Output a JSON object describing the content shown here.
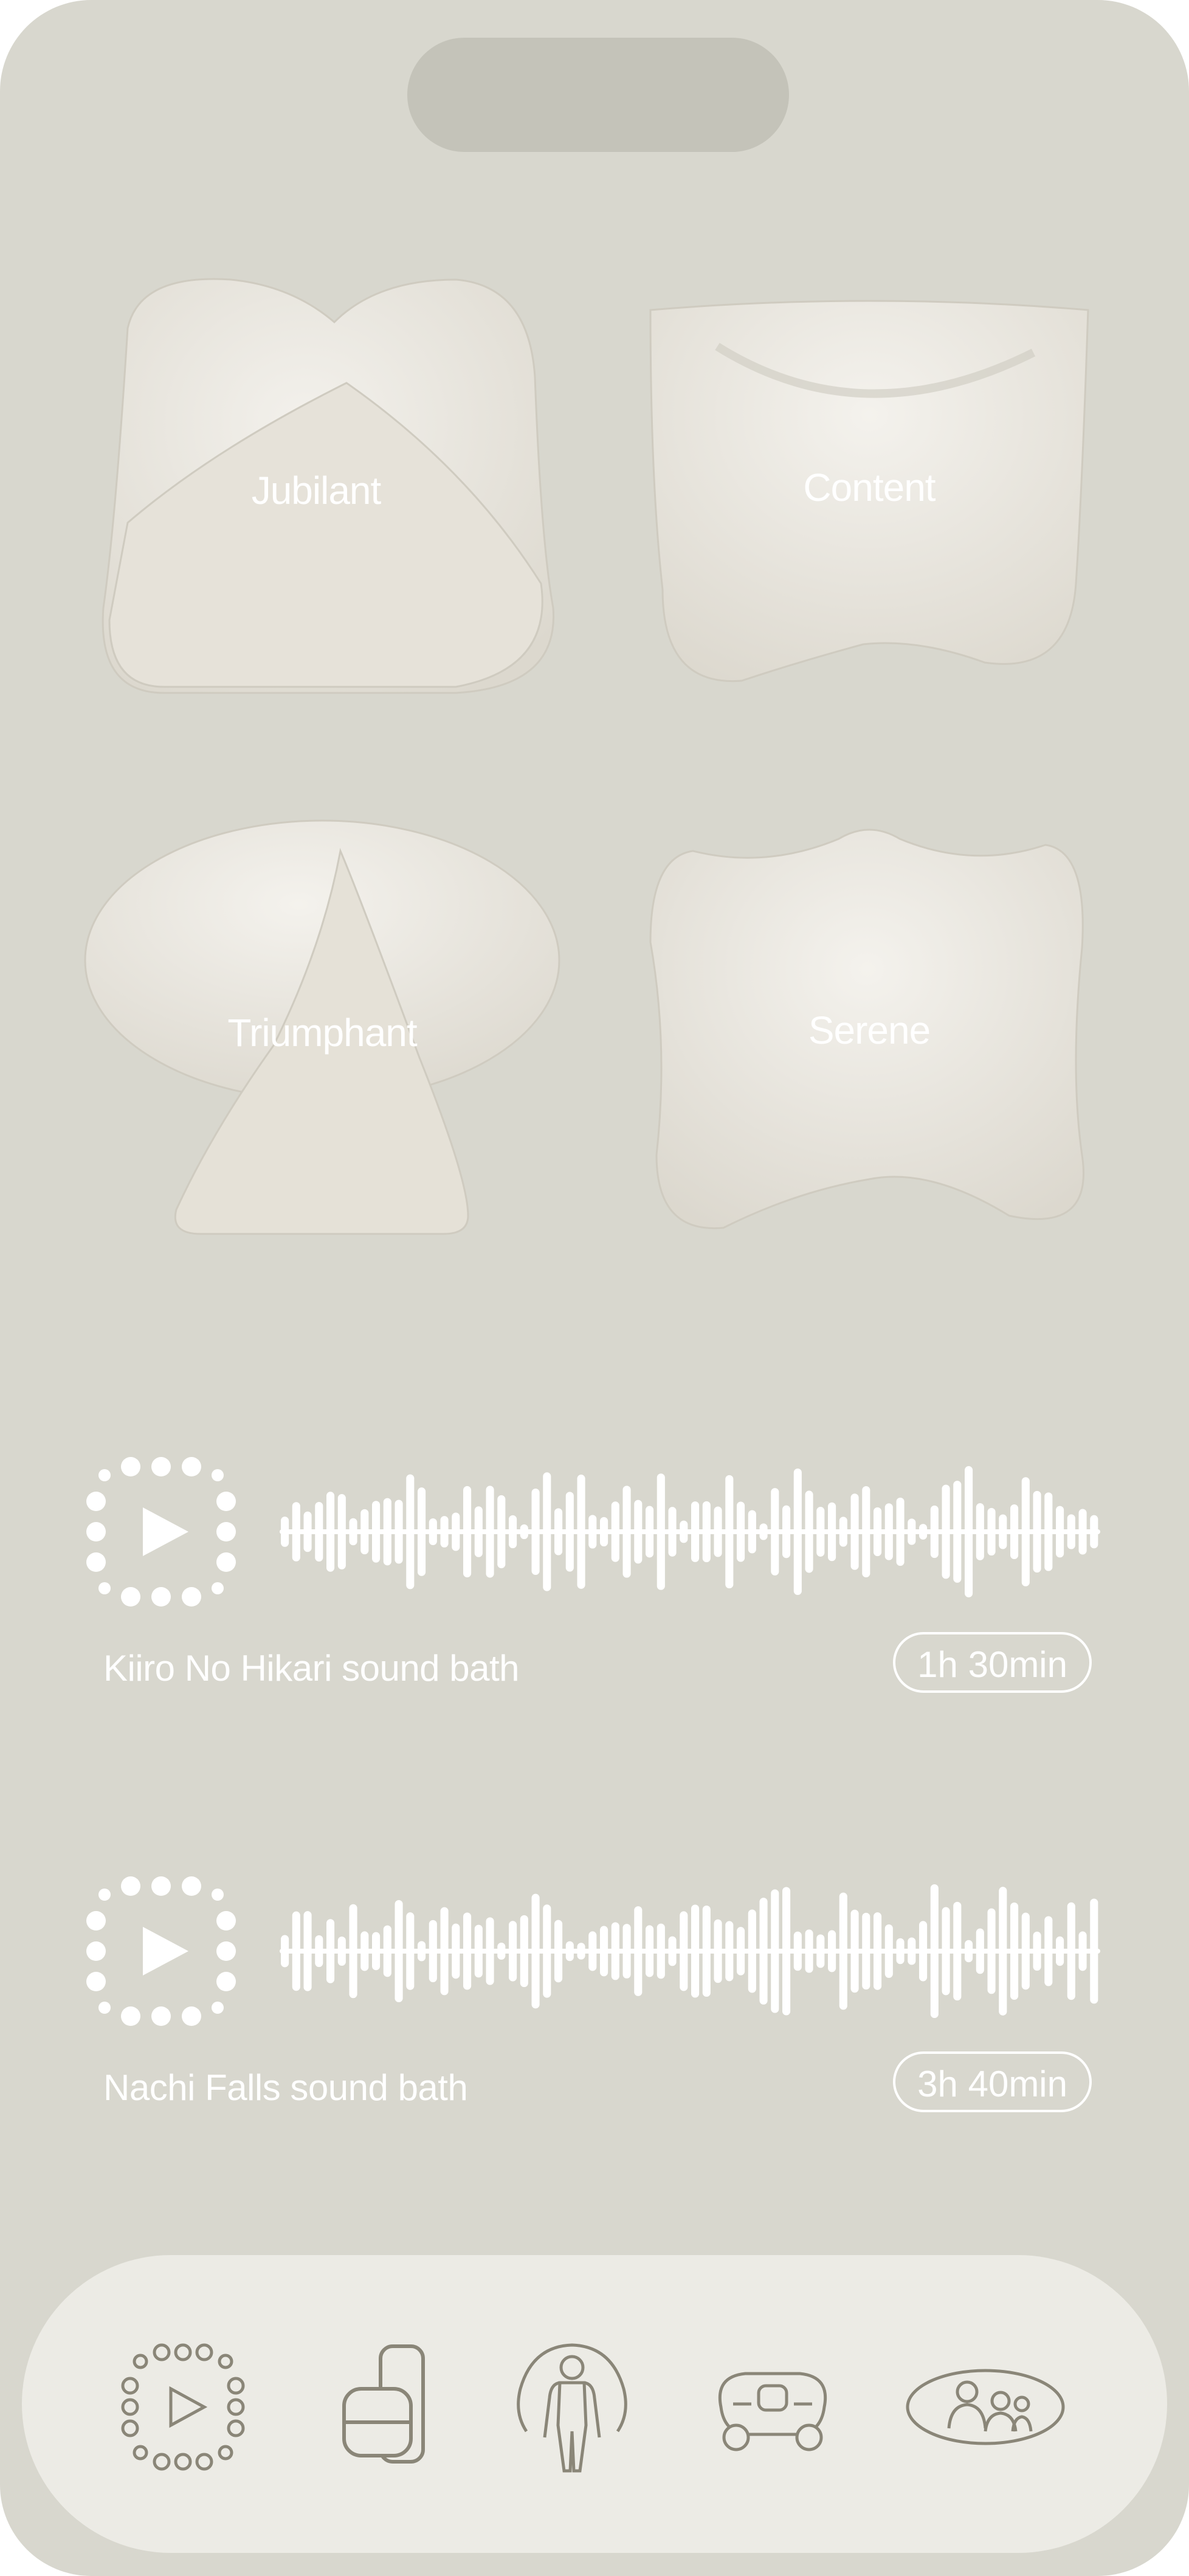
{
  "moods": [
    {
      "label": "Jubilant"
    },
    {
      "label": "Content"
    },
    {
      "label": "Triumphant"
    },
    {
      "label": "Serene"
    }
  ],
  "tracks": [
    {
      "title": "Kiiro No Hikari sound bath",
      "duration": "1h 30min"
    },
    {
      "title": "Nachi Falls sound bath",
      "duration": "3h 40min"
    }
  ],
  "nav": {
    "items": [
      {
        "icon": "play-dots-icon"
      },
      {
        "icon": "objects-icon"
      },
      {
        "icon": "body-icon"
      },
      {
        "icon": "car-icon"
      },
      {
        "icon": "people-icon"
      }
    ]
  },
  "colors": {
    "background": "#d8d7ce",
    "shape": "#e9e6df",
    "navbar": "#ecebe5",
    "icon_stroke": "#8a8678",
    "text": "#ffffff"
  }
}
